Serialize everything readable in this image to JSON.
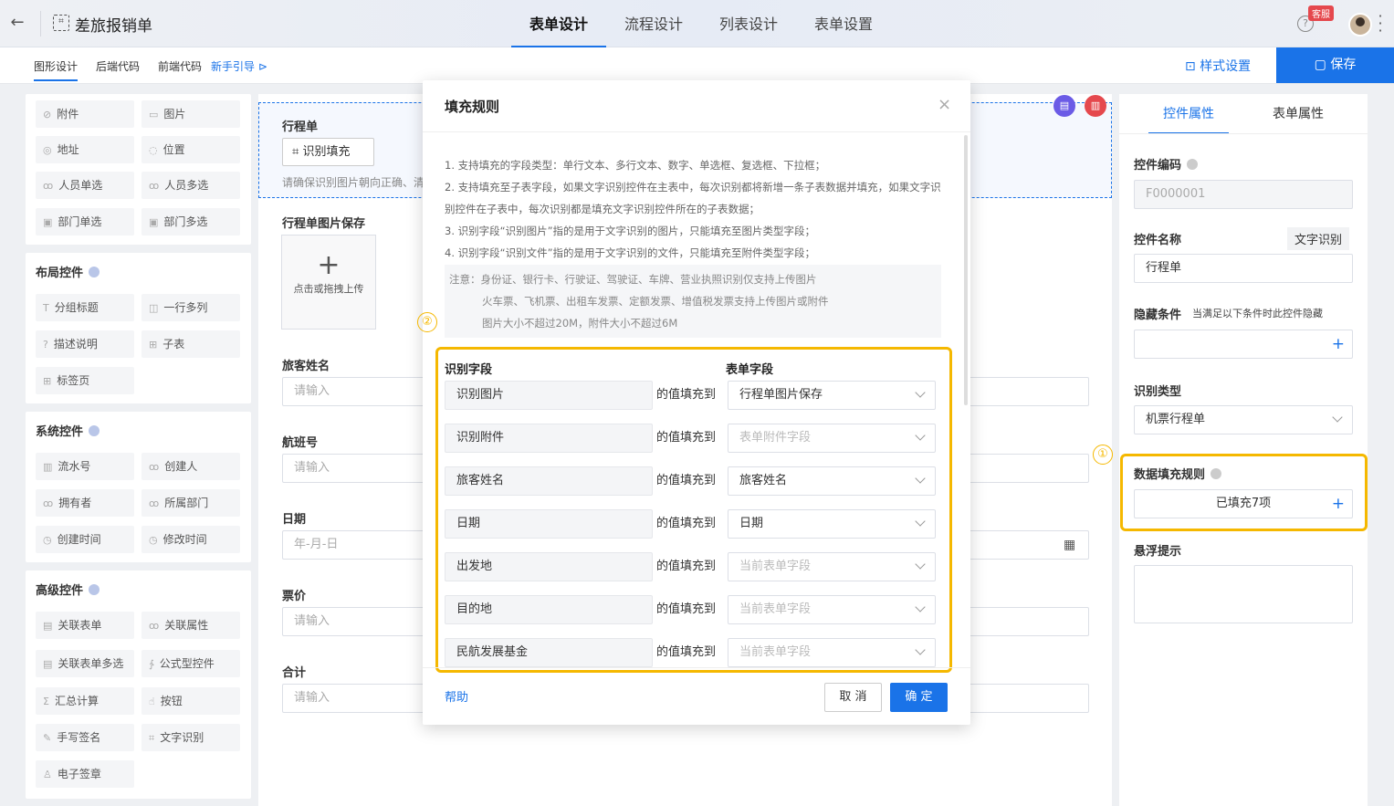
{
  "header": {
    "back_icon": "arrow-left-icon",
    "title": "差旅报销单",
    "tabs": [
      {
        "label": "表单设计"
      },
      {
        "label": "流程设计"
      },
      {
        "label": "列表设计"
      },
      {
        "label": "表单设置"
      }
    ],
    "kefu": "客服",
    "help_glyph": "?"
  },
  "subbar": {
    "items": [
      "图形设计",
      "后端代码",
      "前端代码"
    ],
    "guide": "新手引导",
    "style_settings": "样式设置",
    "save": "保存"
  },
  "left": {
    "basic_items": [
      {
        "label": "附件",
        "icon": "⊘"
      },
      {
        "label": "图片",
        "icon": "▭"
      },
      {
        "label": "地址",
        "icon": "◎"
      },
      {
        "label": "位置",
        "icon": "◌"
      },
      {
        "label": "人员单选",
        "icon": "ꝏ"
      },
      {
        "label": "人员多选",
        "icon": "ꝏ"
      },
      {
        "label": "部门单选",
        "icon": "▣"
      },
      {
        "label": "部门多选",
        "icon": "▣"
      }
    ],
    "layout_title": "布局控件",
    "layout_items": [
      {
        "label": "分组标题",
        "icon": "T"
      },
      {
        "label": "一行多列",
        "icon": "◫"
      },
      {
        "label": "描述说明",
        "icon": "?"
      },
      {
        "label": "子表",
        "icon": "⊞"
      },
      {
        "label": "标签页",
        "icon": "⊞"
      }
    ],
    "system_title": "系统控件",
    "system_items": [
      {
        "label": "流水号",
        "icon": "▥"
      },
      {
        "label": "创建人",
        "icon": "ꝏ"
      },
      {
        "label": "拥有者",
        "icon": "ꝏ"
      },
      {
        "label": "所属部门",
        "icon": "ꝏ"
      },
      {
        "label": "创建时间",
        "icon": "◷"
      },
      {
        "label": "修改时间",
        "icon": "◷"
      }
    ],
    "advanced_title": "高级控件",
    "advanced_items": [
      {
        "label": "关联表单",
        "icon": "▤"
      },
      {
        "label": "关联属性",
        "icon": "ꝏ"
      },
      {
        "label": "关联表单多选",
        "icon": "▤"
      },
      {
        "label": "公式型控件",
        "icon": "∱"
      },
      {
        "label": "汇总计算",
        "icon": "Σ"
      },
      {
        "label": "按钮",
        "icon": "☝"
      },
      {
        "label": "手写签名",
        "icon": "✎"
      },
      {
        "label": "文字识别",
        "icon": "⌗"
      },
      {
        "label": "电子签章",
        "icon": "♙"
      }
    ]
  },
  "canvas": {
    "ocr_label": "行程单",
    "ocr_button": "识别填充",
    "ocr_hint": "请确保识别图片朝向正确、清",
    "image_label": "行程单图片保存",
    "upload_text": "点击或拖拽上传",
    "fields": [
      {
        "label": "旅客姓名",
        "placeholder": "请输入"
      },
      {
        "label": "航班号",
        "placeholder": "请输入"
      },
      {
        "label": "日期",
        "placeholder": "年-月-日"
      },
      {
        "label": "票价",
        "placeholder": "请输入"
      },
      {
        "label": "合计",
        "placeholder": "请输入"
      }
    ]
  },
  "right": {
    "tabs": [
      "控件属性",
      "表单属性"
    ],
    "code_label": "控件编码",
    "code_value": "F0000001",
    "name_label": "控件名称",
    "name_tag": "文字识别",
    "name_value": "行程单",
    "hide_label": "隐藏条件",
    "hide_hint": "当满足以下条件时此控件隐藏",
    "type_label": "识别类型",
    "type_value": "机票行程单",
    "fill_label": "数据填充规则",
    "fill_value": "已填充7项",
    "tooltip_label": "悬浮提示",
    "marker1": "①"
  },
  "modal": {
    "title": "填充规则",
    "close": "×",
    "rules": [
      "1. 支持填充的字段类型：单行文本、多行文本、数字、单选框、复选框、下拉框；",
      "2. 支持填充至子表字段，如果文字识别控件在主表中，每次识别都将新增一条子表数据并填充，如果文字识别控件在子表中，每次识别都是填充文字识别控件所在的子表数据；",
      "3. 识别字段“识别图片”指的是用于文字识别的图片，只能填充至图片类型字段；",
      "4. 识别字段“识别文件”指的是用于文字识别的文件，只能填充至附件类型字段；"
    ],
    "note_lines": [
      "注意：身份证、银行卡、行驶证、驾驶证、车牌、营业执照识别仅支持上传图片",
      "火车票、飞机票、出租车发票、定额发票、增值税发票支持上传图片或附件",
      "图片大小不超过20M，附件大小不超过6M"
    ],
    "marker2": "②",
    "col_source": "识别字段",
    "col_target": "表单字段",
    "mid_text": "的值填充到",
    "rows": [
      {
        "source": "识别图片",
        "target": "行程单图片保存",
        "placeholder": false
      },
      {
        "source": "识别附件",
        "target": "表单附件字段",
        "placeholder": true
      },
      {
        "source": "旅客姓名",
        "target": "旅客姓名",
        "placeholder": false
      },
      {
        "source": "日期",
        "target": "日期",
        "placeholder": false
      },
      {
        "source": "出发地",
        "target": "当前表单字段",
        "placeholder": true
      },
      {
        "source": "目的地",
        "target": "当前表单字段",
        "placeholder": true
      },
      {
        "source": "民航发展基金",
        "target": "当前表单字段",
        "placeholder": true
      }
    ],
    "help": "帮助",
    "cancel": "取 消",
    "ok": "确 定"
  }
}
